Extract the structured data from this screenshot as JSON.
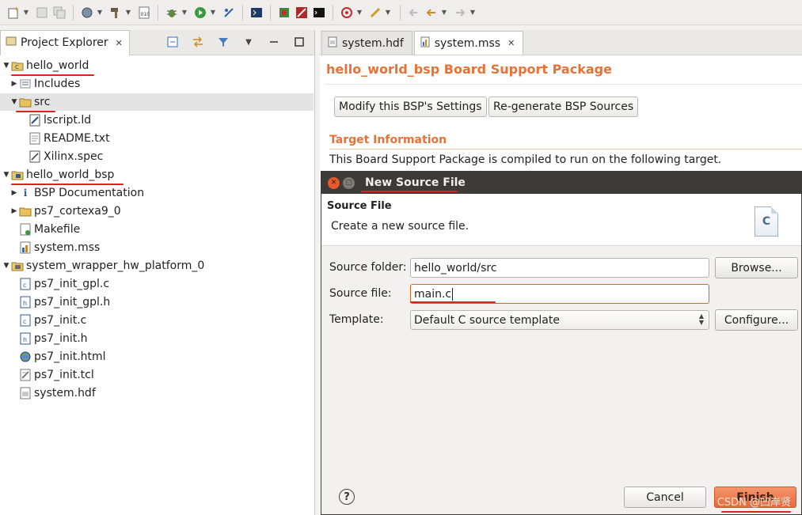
{
  "colors": {
    "accent": "#e97136",
    "annotation_red": "#e02020",
    "dialog_titlebar": "#3c3b37",
    "finish_button": "#e46a3a"
  },
  "toolbar": {
    "icons": [
      "new-icon",
      "save-icon",
      "save-all-icon",
      "debug-config-icon",
      "build-icon",
      "binary-icon",
      "bug-icon",
      "run-icon",
      "skip-breakpoints-icon",
      "terminal-icon",
      "program-fpga-icon",
      "xsdk-icon",
      "console-icon",
      "target-icon",
      "pin-icon",
      "last-edit-icon",
      "back-icon",
      "forward-icon"
    ]
  },
  "explorer": {
    "tab_label": "Project Explorer",
    "tree": [
      {
        "label": "hello_world",
        "icon": "c-project-icon",
        "arrow": "▼"
      },
      {
        "label": "Includes",
        "icon": "includes-icon",
        "arrow": "▶"
      },
      {
        "label": "src",
        "icon": "folder-icon",
        "arrow": "▼"
      },
      {
        "label": "lscript.ld",
        "icon": "linker-file-icon",
        "arrow": ""
      },
      {
        "label": "README.txt",
        "icon": "text-file-icon",
        "arrow": ""
      },
      {
        "label": "Xilinx.spec",
        "icon": "spec-file-icon",
        "arrow": ""
      },
      {
        "label": "hello_world_bsp",
        "icon": "bsp-project-icon",
        "arrow": "▼"
      },
      {
        "label": "BSP Documentation",
        "icon": "info-icon",
        "arrow": "▶"
      },
      {
        "label": "ps7_cortexa9_0",
        "icon": "folder-icon",
        "arrow": "▶"
      },
      {
        "label": "Makefile",
        "icon": "makefile-icon",
        "arrow": ""
      },
      {
        "label": "system.mss",
        "icon": "mss-file-icon",
        "arrow": ""
      },
      {
        "label": "system_wrapper_hw_platform_0",
        "icon": "hw-platform-icon",
        "arrow": "▼"
      },
      {
        "label": "ps7_init_gpl.c",
        "icon": "c-file-icon",
        "arrow": ""
      },
      {
        "label": "ps7_init_gpl.h",
        "icon": "h-file-icon",
        "arrow": ""
      },
      {
        "label": "ps7_init.c",
        "icon": "c-file-icon",
        "arrow": ""
      },
      {
        "label": "ps7_init.h",
        "icon": "h-file-icon",
        "arrow": ""
      },
      {
        "label": "ps7_init.html",
        "icon": "html-file-icon",
        "arrow": ""
      },
      {
        "label": "ps7_init.tcl",
        "icon": "tcl-file-icon",
        "arrow": ""
      },
      {
        "label": "system.hdf",
        "icon": "hdf-file-icon",
        "arrow": ""
      }
    ]
  },
  "editor": {
    "tabs": [
      {
        "label": "system.hdf"
      },
      {
        "label": "system.mss"
      }
    ],
    "title": "hello_world_bsp Board Support Package",
    "modify_button": "Modify this BSP's Settings",
    "regenerate_button": "Re-generate BSP Sources",
    "target_heading": "Target Information",
    "target_text": "This Board Support Package is compiled to run on the following target."
  },
  "dialog": {
    "title": "New Source File",
    "section_title": "Source File",
    "description": "Create a new source file.",
    "file_icon_letter": "C",
    "source_folder_label": "Source folder:",
    "source_folder_value": "hello_world/src",
    "browse_button": "Browse...",
    "source_file_label": "Source file:",
    "source_file_value": "main.c",
    "template_label": "Template:",
    "template_value": "Default C source template",
    "configure_button": "Configure...",
    "help_symbol": "?",
    "cancel_button": "Cancel",
    "finish_button": "Finish"
  },
  "watermark": "CSDN @凹岸贤"
}
